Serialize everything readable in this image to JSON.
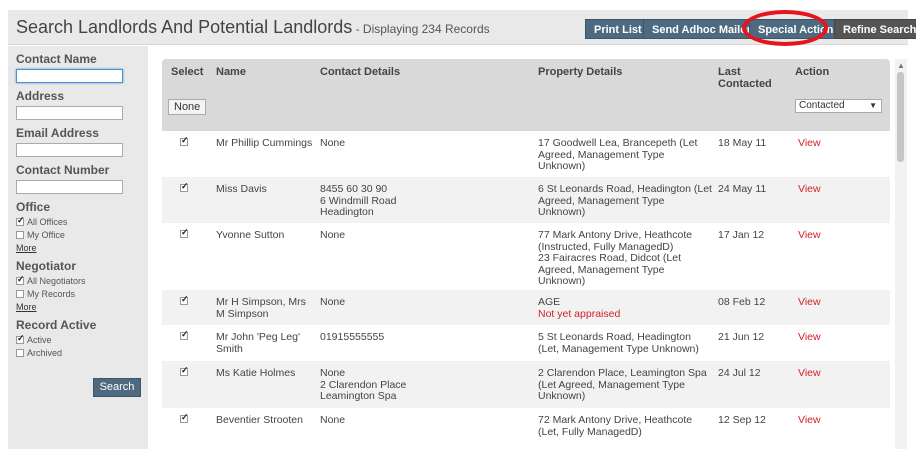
{
  "header": {
    "title": "Search Landlords And Potential Landlords",
    "subtitle": " - Displaying 234 Records",
    "buttons": {
      "print_list": "Print List",
      "send_adhoc_mailout": "Send Adhoc Mailout",
      "special_actions": "Special Actions",
      "refine_search": "Refine Search"
    },
    "highlight_color": "#e8141c"
  },
  "sidebar": {
    "contact_name_label": "Contact Name",
    "contact_name_value": "",
    "address_label": "Address",
    "address_value": "",
    "email_label": "Email Address",
    "email_value": "",
    "contact_number_label": "Contact Number",
    "contact_number_value": "",
    "office": {
      "label": "Office",
      "options": [
        {
          "label": "All Offices",
          "checked": true
        },
        {
          "label": "My Office",
          "checked": false
        }
      ],
      "more": "More"
    },
    "negotiator": {
      "label": "Negotiator",
      "options": [
        {
          "label": "All Negotiators",
          "checked": true
        },
        {
          "label": "My Records",
          "checked": false
        }
      ],
      "more": "More"
    },
    "record_active": {
      "label": "Record Active",
      "options": [
        {
          "label": "Active",
          "checked": true
        },
        {
          "label": "Archived",
          "checked": false
        }
      ]
    },
    "search_button": "Search"
  },
  "table": {
    "headers": {
      "select": "Select",
      "name": "Name",
      "contact": "Contact Details",
      "property": "Property Details",
      "last_contacted": "Last Contacted",
      "action": "Action"
    },
    "none_button": "None",
    "action_select_value": "Contacted",
    "rows": [
      {
        "checked": true,
        "name": "Mr Phillip Cummings",
        "contact": "None",
        "property": "17 Goodwell Lea, Brancepeth (Let Agreed, Management Type Unknown)",
        "property_extra": "",
        "date": "18 May 11",
        "action": "View"
      },
      {
        "checked": true,
        "name": "Miss Davis",
        "contact": "8455 60 30 90\n6 Windmill Road\nHeadington",
        "property": "6 St Leonards Road, Headington (Let Agreed, Management Type Unknown)",
        "property_extra": "",
        "date": "24 May 11",
        "action": "View"
      },
      {
        "checked": true,
        "name": "Yvonne Sutton",
        "contact": "None",
        "property": "77 Mark Antony Drive, Heathcote (Instructed, Fully ManagedD)\n23 Fairacres Road, Didcot (Let Agreed, Management Type Unknown)",
        "property_extra": "",
        "date": "17 Jan 12",
        "action": "View"
      },
      {
        "checked": true,
        "name": "Mr H Simpson, Mrs M Simpson",
        "contact": "None",
        "property": "AGE",
        "property_extra": "Not yet appraised",
        "date": "08 Feb 12",
        "action": "View"
      },
      {
        "checked": true,
        "name": "Mr John 'Peg Leg' Smith",
        "contact": "01915555555",
        "property": "5 St Leonards Road, Headington (Let, Management Type Unknown)",
        "property_extra": "",
        "date": "21 Jun 12",
        "action": "View"
      },
      {
        "checked": true,
        "name": "Ms Katie Holmes",
        "contact": "None\n2 Clarendon Place\nLeamington Spa",
        "property": "2 Clarendon Place, Leamington Spa (Let Agreed, Management Type Unknown)",
        "property_extra": "",
        "date": "24 Jul 12",
        "action": "View"
      },
      {
        "checked": true,
        "name": "Beventier Strooten",
        "contact": "None",
        "property": "72 Mark Antony Drive, Heathcote (Let, Fully ManagedD)",
        "property_extra": "",
        "date": "12 Sep 12",
        "action": "View"
      }
    ]
  }
}
